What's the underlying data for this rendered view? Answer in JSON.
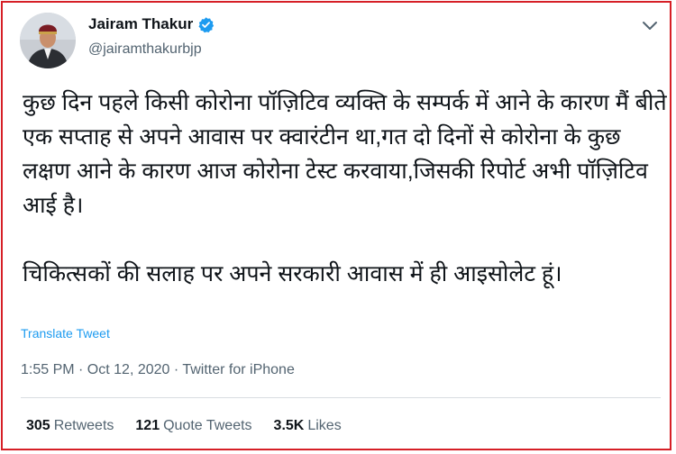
{
  "tweet": {
    "author_name": "Jairam Thakur",
    "handle": "@jairamthakurbjp",
    "paragraphs": [
      "कुछ दिन पहले किसी कोरोना पॉज़िटिव व्यक्ति के सम्पर्क में आने के कारण मैं बीते एक सप्ताह से अपने आवास पर क्वारंटीन था,गत दो दिनों से कोरोना के कुछ लक्षण आने के कारण आज कोरोना टेस्ट करवाया,जिसकी रिपोर्ट अभी पॉज़िटिव आई है।",
      "चिकित्सकों की सलाह पर अपने सरकारी आवास में ही आइसोलेट हूं।"
    ],
    "translate_label": "Translate Tweet",
    "meta": "1:55 PM · Oct 12, 2020 · Twitter for iPhone",
    "stats": {
      "retweets_count": "305",
      "retweets_label": "Retweets",
      "quotes_count": "121",
      "quotes_label": "Quote Tweets",
      "likes_count": "3.5K",
      "likes_label": "Likes"
    }
  },
  "colors": {
    "frame_border": "#d61f26",
    "verified_badge": "#1d9bf0",
    "link": "#1d9bf0"
  },
  "icons": {
    "verified": "verified-badge-icon",
    "more": "chevron-down-icon"
  }
}
